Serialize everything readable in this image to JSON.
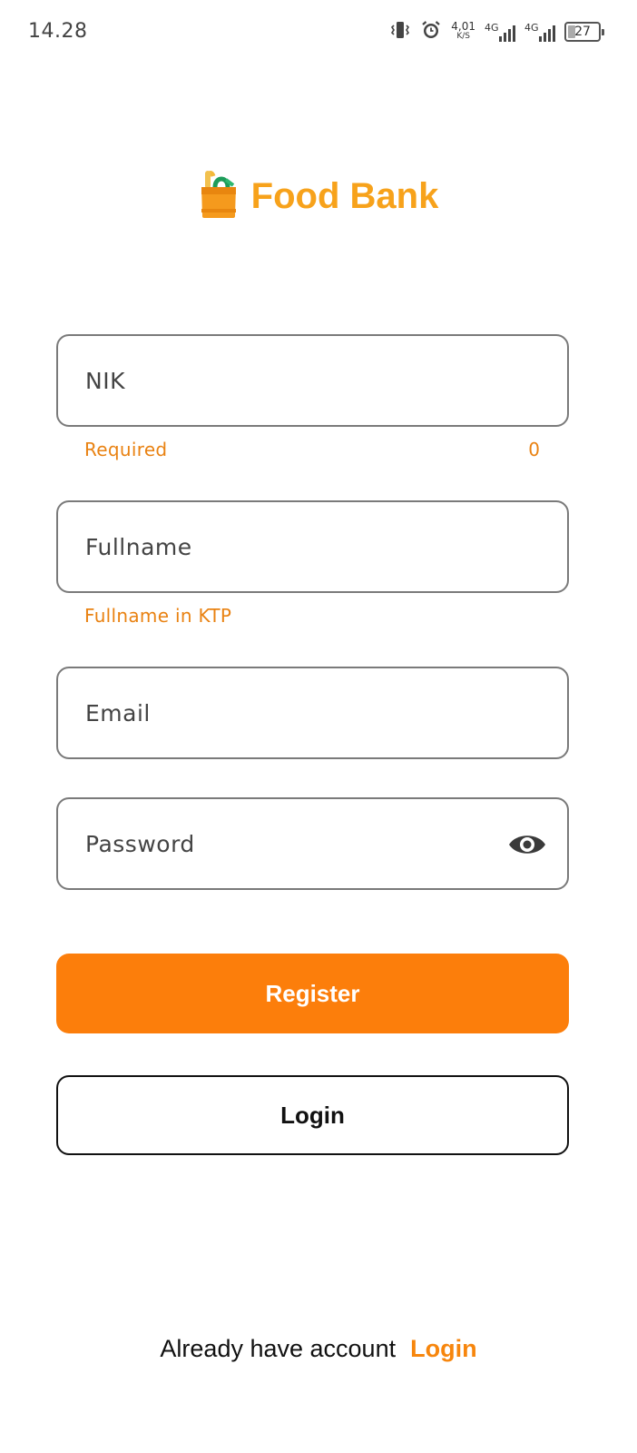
{
  "status_bar": {
    "time": "14.28",
    "net_speed_value": "4,01",
    "net_speed_unit": "K/S",
    "sim1_label": "4G",
    "sim2_label": "4G",
    "battery_level": "27"
  },
  "brand": {
    "title": "Food Bank",
    "color": "#F7A21B"
  },
  "form": {
    "nik": {
      "placeholder": "NIK",
      "value": "",
      "helper": "Required",
      "counter": "0"
    },
    "fullname": {
      "placeholder": "Fullname",
      "value": "",
      "helper": "Fullname in KTP"
    },
    "email": {
      "placeholder": "Email",
      "value": ""
    },
    "password": {
      "placeholder": "Password",
      "value": "",
      "toggle_icon": "eye-icon"
    }
  },
  "buttons": {
    "register_label": "Register",
    "login_label": "Login"
  },
  "footer": {
    "question": "Already have account",
    "link": "Login"
  },
  "colors": {
    "accent": "#FC7E0B",
    "helper_text": "#E98212",
    "border": "#7a7a7a"
  }
}
